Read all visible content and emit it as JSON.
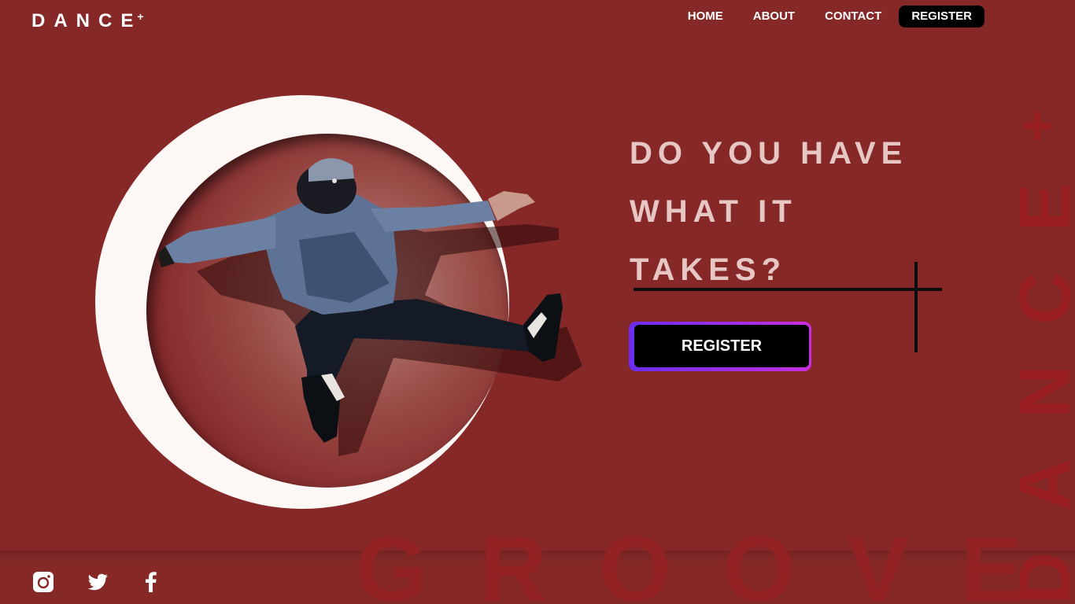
{
  "logo": {
    "text": "DANCE",
    "superscript": "+"
  },
  "nav": {
    "items": [
      "HOME",
      "ABOUT",
      "CONTACT"
    ],
    "register_label": "REGISTER"
  },
  "hero": {
    "headline_lines": [
      "DO YOU HAVE",
      "WHAT IT",
      "TAKES?"
    ],
    "cta_label": "REGISTER"
  },
  "background_text": {
    "vertical": "DANCE",
    "vertical_superscript": "+",
    "bottom": "GROOVE"
  },
  "social": {
    "icons": [
      "instagram-icon",
      "twitter-icon",
      "facebook-icon"
    ]
  },
  "colors": {
    "background": "#862828",
    "ring": "#fdf7f5",
    "headline": "#e6c7c4",
    "cta_border_start": "#6a2df0",
    "cta_border_end": "#c82fe0"
  }
}
